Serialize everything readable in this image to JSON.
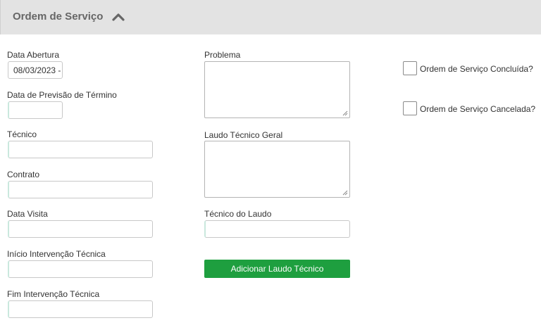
{
  "header": {
    "title": "Ordem de Serviço",
    "toggle_icon": "chevron-up-icon"
  },
  "left_column": {
    "data_abertura": {
      "label": "Data Abertura",
      "value": "08/03/2023 -"
    },
    "data_previsao": {
      "label": "Data de Previsão de Término",
      "value": ""
    },
    "tecnico": {
      "label": "Técnico",
      "value": ""
    },
    "contrato": {
      "label": "Contrato",
      "value": ""
    },
    "data_visita": {
      "label": "Data Visita",
      "value": ""
    },
    "inicio_intervencao": {
      "label": "Início Intervenção Técnica",
      "value": ""
    },
    "fim_intervencao": {
      "label": "Fim Intervenção Técnica",
      "value": ""
    }
  },
  "middle_column": {
    "problema": {
      "label": "Problema",
      "value": ""
    },
    "laudo_geral": {
      "label": "Laudo Técnico Geral",
      "value": ""
    },
    "tecnico_laudo": {
      "label": "Técnico do Laudo",
      "value": ""
    },
    "add_button_label": "Adicionar Laudo Técnico"
  },
  "right_column": {
    "concluida": {
      "label": "Ordem de Serviço Concluída?",
      "checked": false
    },
    "cancelada": {
      "label": "Ordem de Serviço Cancelada?",
      "checked": false
    }
  },
  "colors": {
    "header_bg": "#e3e3e3",
    "button_bg": "#1e9f3f",
    "input_accent": "#c9e8dd"
  }
}
